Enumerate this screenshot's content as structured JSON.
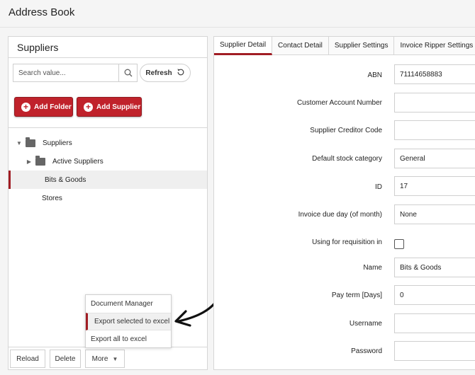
{
  "app": {
    "title": "Address Book"
  },
  "left": {
    "header": "Suppliers",
    "search_placeholder": "Search value...",
    "refresh_label": "Refresh",
    "add_folder_label": "Add Folder",
    "add_supplier_label": "Add Supplier",
    "tree": [
      {
        "label": "Suppliers"
      },
      {
        "label": "Active Suppliers"
      },
      {
        "label": "Bits & Goods"
      },
      {
        "label": "Stores"
      }
    ],
    "reload_label": "Reload",
    "delete_label": "Delete",
    "more_label": "More",
    "more_menu": [
      {
        "label": "Document Manager"
      },
      {
        "label": "Export selected to excel"
      },
      {
        "label": "Export all to excel"
      }
    ]
  },
  "right": {
    "tabs": [
      {
        "label": "Supplier Detail"
      },
      {
        "label": "Contact Detail"
      },
      {
        "label": "Supplier Settings"
      },
      {
        "label": "Invoice Ripper Settings"
      }
    ],
    "fields": [
      {
        "label": "ABN",
        "value": "71114658883"
      },
      {
        "label": "Customer Account Number",
        "value": ""
      },
      {
        "label": "Supplier Creditor Code",
        "value": ""
      },
      {
        "label": "Default stock category",
        "value": "General"
      },
      {
        "label": "ID",
        "value": "17"
      },
      {
        "label": "Invoice due day (of month)",
        "value": "None"
      },
      {
        "label": "Using for requisition in",
        "value": ""
      },
      {
        "label": "Name",
        "value": "Bits & Goods"
      },
      {
        "label": "Pay term [Days]",
        "value": "0"
      },
      {
        "label": "Username",
        "value": ""
      },
      {
        "label": "Password",
        "value": ""
      }
    ]
  },
  "colors": {
    "accent": "#c0222b",
    "selection_bar": "#a11d24"
  }
}
